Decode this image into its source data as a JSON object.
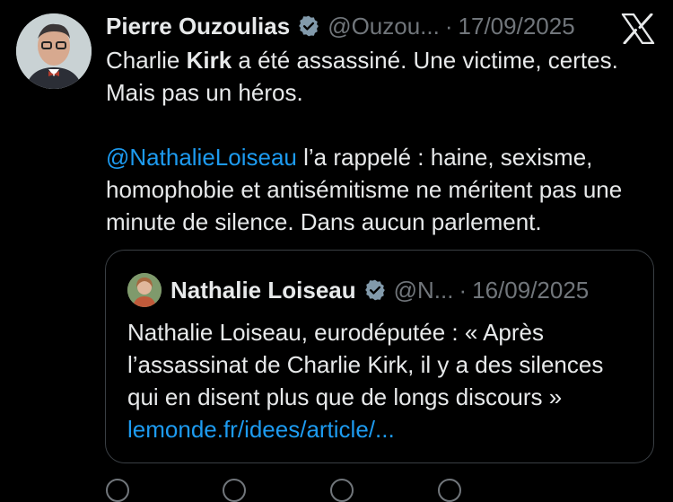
{
  "tweet": {
    "author_name": "Pierre Ouzoulias",
    "author_handle": "@Ouzou...",
    "separator": "·",
    "date": "17/09/2025",
    "text_line1_pre": "Charlie ",
    "text_line1_bold": "Kirk",
    "text_line1_post": " a été assassiné. Une victime, certes. Mais pas un héros.",
    "mention": "@NathalieLoiseau",
    "text_line2": " l’a rappelé : haine, sexisme, homophobie et antisémitisme ne méritent pas une minute de silence. Dans aucun parlement."
  },
  "quote": {
    "author_name": "Nathalie Loiseau",
    "author_handle": "@N...",
    "separator": "·",
    "date": "16/09/2025",
    "text": "Nathalie Loiseau, eurodéputée : « Après l’assassinat de Charlie Kirk, il y a des silences qui en disent plus que de longs discours » ",
    "link": "lemonde.fr/idees/article/..."
  },
  "colors": {
    "background": "#000000",
    "text": "#e7e9ea",
    "muted": "#71767b",
    "link": "#1d9bf0",
    "verified_badge": "#829aab"
  },
  "icons": [
    "avatar",
    "verified-badge-icon",
    "x-logo-icon"
  ]
}
